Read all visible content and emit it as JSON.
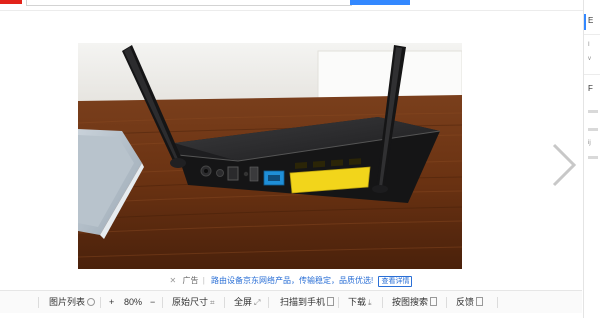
{
  "ad": {
    "close_glyph": "✕",
    "label": "广告",
    "separator": "|",
    "text": "路由设备京东网络产品，传输稳定，品质优选!",
    "detail_button": "查看详情"
  },
  "toolbar": {
    "image_list": "图片列表",
    "zoom_in": "+",
    "zoom_level": "80%",
    "zoom_out": "−",
    "original_size": "原始尺寸",
    "fullscreen": "全屏",
    "scan_to_phone": "扫描到手机",
    "download": "下载",
    "search_by_image": "按图搜索",
    "feedback": "反馈"
  },
  "sidebar": {
    "tab_label": "E",
    "char_1": "I",
    "char_2": "v",
    "char_3": "ij",
    "char_4": "F"
  },
  "colors": {
    "accent": "#3388ff",
    "brand": "#e2231a",
    "link": "#2a6fd6",
    "port_blue": "#1f8fd8",
    "port_yellow": "#f2d51b"
  },
  "icons": {
    "next": "chevron-right-icon",
    "ad_close": "close-icon",
    "image_list": "list-circle-icon",
    "original_size": "resize-icon",
    "fullscreen": "fullscreen-icon",
    "scan": "phone-icon",
    "download": "download-icon",
    "search": "image-search-icon",
    "feedback": "feedback-icon"
  }
}
